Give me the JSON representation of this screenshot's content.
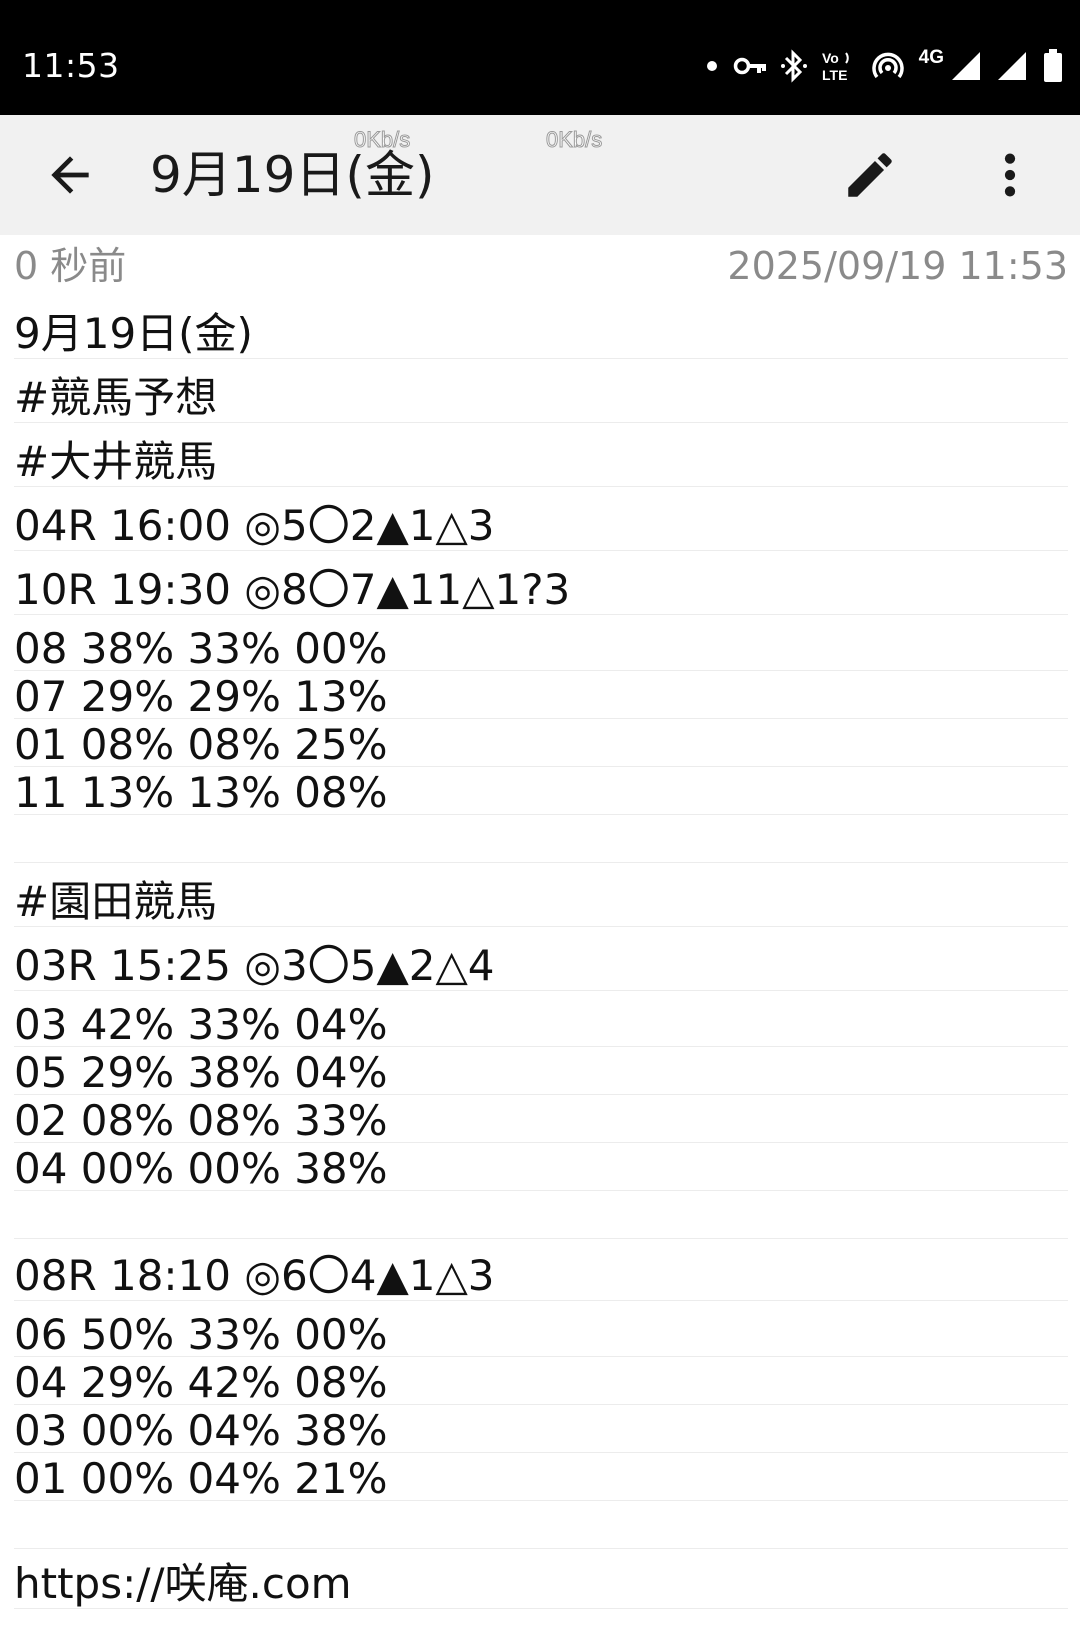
{
  "status_bar": {
    "time": "11:53",
    "network_label": "4G",
    "icons": [
      "dot-icon",
      "vpn-key-icon",
      "bluetooth-icon",
      "volte-icon",
      "hotspot-icon",
      "signal-icon",
      "signal-icon",
      "battery-icon"
    ]
  },
  "toolbar": {
    "title": "9月19日(金)",
    "speed_1": "0Kb/s",
    "speed_2": "0Kb/s"
  },
  "meta": {
    "relative_time": "0 秒前",
    "timestamp": "2025/09/19 11:53"
  },
  "note_lines": [
    "9月19日(金)",
    "#競馬予想",
    "#大井競馬",
    "04R 16:00 ◎5〇2▲1△3",
    "10R 19:30 ◎8〇7▲11△1?3",
    "08 38% 33% 00%",
    "07 29% 29% 13%",
    "01 08% 08% 25%",
    "11 13% 13% 08%",
    "",
    "#園田競馬",
    "03R 15:25 ◎3〇5▲2△4",
    "03 42% 33% 04%",
    "05 29% 38% 04%",
    "02 08% 08% 33%",
    "04 00% 00% 38%",
    "",
    "08R 18:10 ◎6〇4▲1△3",
    "06 50% 33% 00%",
    "04 29% 42% 08%",
    "03 00% 04% 38%",
    "01 00% 04% 21%",
    "",
    "https://咲庵.com"
  ]
}
